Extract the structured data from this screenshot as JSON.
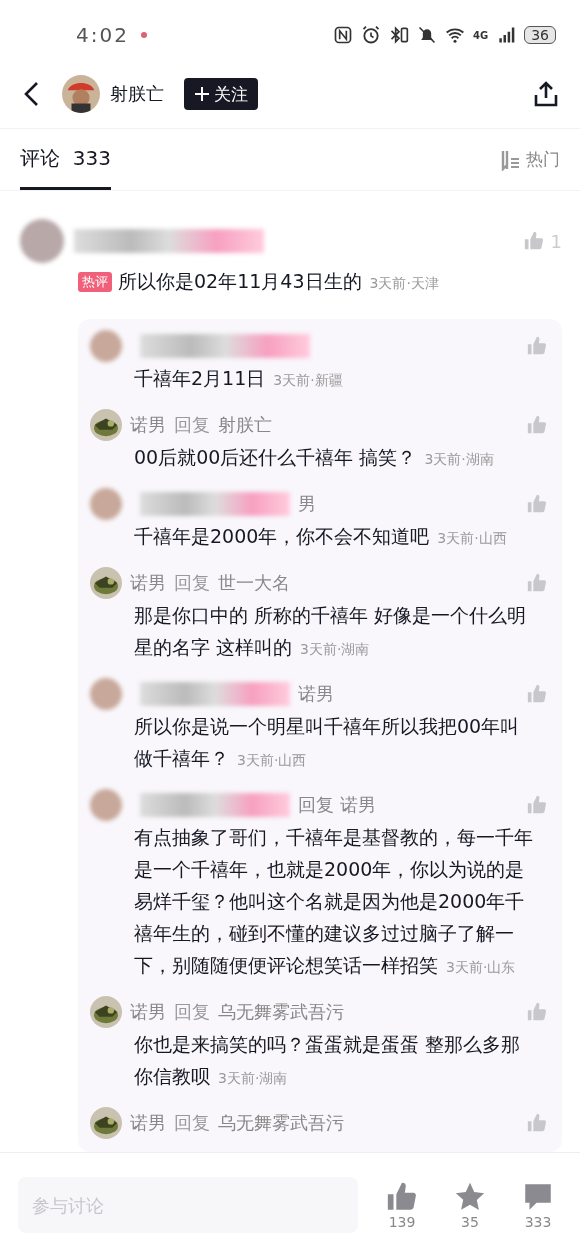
{
  "status_bar": {
    "time": "4:02",
    "network": "4G",
    "battery": "36"
  },
  "header": {
    "author": "射朕亡",
    "follow": "关注"
  },
  "tabs": [
    {
      "label": "评论",
      "count": "333",
      "selected": true
    }
  ],
  "sort": {
    "label": "热门"
  },
  "comment": {
    "likes": "1",
    "badge": "热评",
    "text": "所以你是02年11月43日生的",
    "meta": "3天前·天津"
  },
  "replies": [
    {
      "kind": "blurred",
      "text": "千禧年2月11日",
      "meta": "3天前·新疆"
    },
    {
      "kind": "named",
      "author": "诺男",
      "action": "回复",
      "reply_to": "射朕亡",
      "text": "00后就00后还什么千禧年  搞笑？",
      "meta": "3天前·湖南"
    },
    {
      "kind": "blurred",
      "name_tail": "男",
      "text": "千禧年是2000年，你不会不知道吧",
      "meta": "3天前·山西"
    },
    {
      "kind": "named",
      "author": "诺男",
      "action": "回复",
      "reply_to": "世一大名",
      "text": "那是你口中的 所称的千禧年 好像是一个什么明星的名字 这样叫的",
      "meta": "3天前·湖南"
    },
    {
      "kind": "blurred",
      "name_tail": "诺男",
      "text": "所以你是说一个明星叫千禧年所以我把00年叫做千禧年？",
      "meta": "3天前·山西"
    },
    {
      "kind": "blurred",
      "name_tail": "回复 诺男",
      "text": "有点抽象了哥们，千禧年是基督教的，每一千年是一个千禧年，也就是2000年，你以为说的是易烊千玺？他叫这个名就是因为他是2000年千禧年生的，碰到不懂的建议多过过脑子了解一下，别随随便便评论想笑话一样招笑",
      "meta": "3天前·山东"
    },
    {
      "kind": "named",
      "author": "诺男",
      "action": "回复",
      "reply_to": "乌无舞雾武吾污",
      "text": "你也是来搞笑的吗？蛋蛋就是蛋蛋 整那么多那你信教呗",
      "meta": "3天前·湖南"
    },
    {
      "kind": "named",
      "author": "诺男",
      "action": "回复",
      "reply_to": "乌无舞雾武吾污"
    }
  ],
  "bottom_bar": {
    "placeholder": "参与讨论",
    "actions": [
      {
        "kind": "like",
        "count": "139"
      },
      {
        "kind": "star",
        "count": "35"
      },
      {
        "kind": "comment",
        "count": "333"
      }
    ]
  }
}
